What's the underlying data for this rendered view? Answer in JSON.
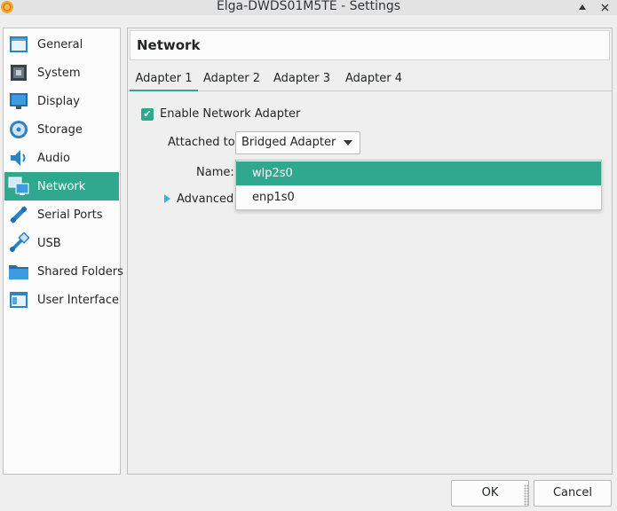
{
  "window": {
    "title": "Elga-DWDS01M5TE - Settings"
  },
  "sidebar": {
    "items": [
      {
        "label": "General",
        "icon": "general-icon"
      },
      {
        "label": "System",
        "icon": "system-icon"
      },
      {
        "label": "Display",
        "icon": "display-icon"
      },
      {
        "label": "Storage",
        "icon": "storage-icon"
      },
      {
        "label": "Audio",
        "icon": "audio-icon"
      },
      {
        "label": "Network",
        "icon": "network-icon",
        "active": true
      },
      {
        "label": "Serial Ports",
        "icon": "serial-ports-icon"
      },
      {
        "label": "USB",
        "icon": "usb-icon"
      },
      {
        "label": "Shared Folders",
        "icon": "folder-icon"
      },
      {
        "label": "User Interface",
        "icon": "user-interface-icon"
      }
    ]
  },
  "page": {
    "title": "Network"
  },
  "tabs": [
    "Adapter 1",
    "Adapter 2",
    "Adapter 3",
    "Adapter 4"
  ],
  "adapter": {
    "enable_label": "Enable Network Adapter",
    "enabled": true,
    "attached_label": "Attached to:",
    "attached_value": "Bridged Adapter",
    "name_label": "Name:",
    "advanced_label": "Advanced"
  },
  "name_dropdown": {
    "options": [
      "wlp2s0",
      "enp1s0"
    ],
    "selected": "wlp2s0"
  },
  "buttons": {
    "ok": "OK",
    "cancel": "Cancel"
  },
  "colors": {
    "accent": "#2fa88f",
    "focus": "#3daee9"
  }
}
